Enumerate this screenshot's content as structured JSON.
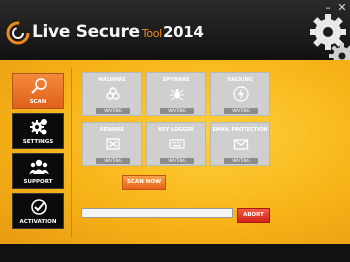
{
  "header": {
    "brand_main": "Live Secure",
    "brand_tool": "Tool",
    "brand_year": "2014",
    "minimize_icon": "minimize-icon",
    "close_icon": "close-icon"
  },
  "sidebar": {
    "items": [
      {
        "label": "SCAN",
        "icon": "magnifier-icon",
        "active": true
      },
      {
        "label": "SETTINGS",
        "icon": "gears-icon",
        "active": false
      },
      {
        "label": "SUPPORT",
        "icon": "people-icon",
        "active": false
      },
      {
        "label": "ACTIVATION",
        "icon": "checkmark-icon",
        "active": false
      }
    ]
  },
  "modules": [
    {
      "title": "MALWARE",
      "status": "WAITING",
      "icon": "biohazard-icon"
    },
    {
      "title": "SPYWARE",
      "status": "WAITING",
      "icon": "spider-icon"
    },
    {
      "title": "HACKING",
      "status": "WAITING",
      "icon": "lightning-icon"
    },
    {
      "title": "ADWARE",
      "status": "WAITING",
      "icon": "ad-block-icon"
    },
    {
      "title": "KEY LOGGER",
      "status": "WAITING",
      "icon": "keyboard-icon"
    },
    {
      "title": "EMAIL PROTECTION",
      "status": "WAITING",
      "icon": "envelope-icon"
    }
  ],
  "actions": {
    "scan_now": "SCAN NOW",
    "abort": "ABORT"
  },
  "progress": {
    "fraction": 0
  },
  "colors": {
    "accent_orange": "#f08a1c",
    "panel_yellow": "#f7b418",
    "abort_red": "#d2241a",
    "dark_bg": "#151515"
  }
}
